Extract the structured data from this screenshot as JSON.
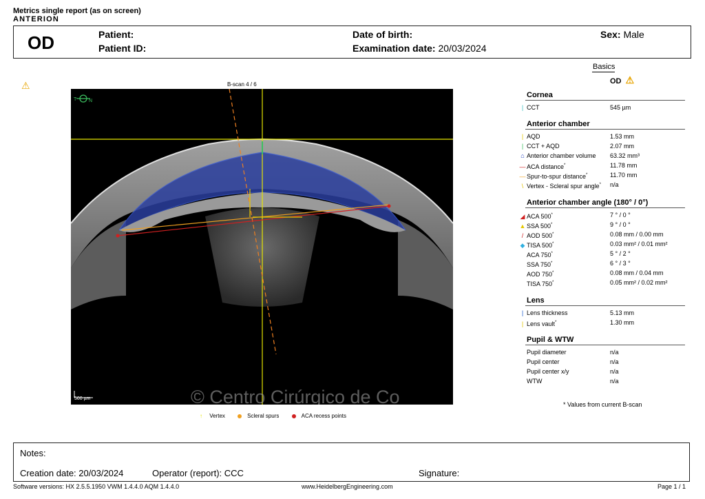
{
  "report": {
    "title": "Metrics single report (as on screen)",
    "brand": "ANTERION"
  },
  "header": {
    "eye": "OD",
    "patient_label": "Patient:",
    "patient_value": "",
    "patient_id_label": "Patient ID:",
    "patient_id_value": "",
    "dob_label": "Date of birth:",
    "dob_value": "",
    "exam_label": "Examination date:",
    "exam_value": "20/03/2024",
    "sex_label": "Sex:",
    "sex_value": "Male"
  },
  "basics": {
    "tab": "Basics",
    "eye": "OD"
  },
  "scan": {
    "caption": "B-scan  4  / 6",
    "orient_t": "T",
    "orient_n": "N",
    "scale_label": "500 µm",
    "watermark": "© Centro Cirúrgico de Co"
  },
  "legend": {
    "vertex": "Vertex",
    "scleral_spurs": "Scleral spurs",
    "aca_recess": "ACA recess points"
  },
  "sections": {
    "cornea": {
      "title": "Cornea",
      "rows": [
        {
          "label": "CCT",
          "value": "545 µm",
          "marker": "|",
          "color": "#3cc0c0",
          "asterisk": ""
        }
      ]
    },
    "anterior_chamber": {
      "title": "Anterior chamber",
      "rows": [
        {
          "label": "AQD",
          "value": "1.53 mm",
          "marker": "|",
          "color": "#e6c800",
          "asterisk": ""
        },
        {
          "label": "CCT + AQD",
          "value": "2.07 mm",
          "marker": "|",
          "color": "#3cc060",
          "asterisk": ""
        },
        {
          "label": "Anterior chamber volume",
          "value": "63.32 mm³",
          "marker": "⌂",
          "color": "#2040c0",
          "asterisk": ""
        },
        {
          "label": "ACA distance",
          "value": "11.78 mm",
          "marker": "—",
          "color": "#d02020",
          "asterisk": "*"
        },
        {
          "label": "Spur-to-spur distance",
          "value": "11.70 mm",
          "marker": "—",
          "color": "#f0a020",
          "asterisk": "*"
        },
        {
          "label": "Vertex - Scleral spur angle",
          "value": "n/a",
          "marker": "\\",
          "color": "#e0c000",
          "asterisk": "*"
        }
      ]
    },
    "chamber_angle": {
      "title": "Anterior chamber angle (180° / 0°)",
      "rows": [
        {
          "label": "ACA 500",
          "value": "7 ° / 0 °",
          "marker": "◢",
          "color": "#d02020",
          "asterisk": "*"
        },
        {
          "label": "SSA 500",
          "value": "9 ° / 0 °",
          "marker": "▲",
          "color": "#e6c800",
          "asterisk": "*"
        },
        {
          "label": "AOD 500",
          "value": "0.08 mm / 0.00 mm",
          "marker": "/",
          "color": "#d02020",
          "asterisk": "*"
        },
        {
          "label": "TISA 500",
          "value": "0.03 mm² / 0.01 mm²",
          "marker": "◆",
          "color": "#30b0e0",
          "asterisk": "*"
        },
        {
          "label": "ACA 750",
          "value": "5 ° / 2 °",
          "marker": "",
          "color": "#000000",
          "asterisk": "*"
        },
        {
          "label": "SSA 750",
          "value": "6 ° / 3 °",
          "marker": "",
          "color": "#000000",
          "asterisk": "*"
        },
        {
          "label": "AOD 750",
          "value": "0.08 mm / 0.04 mm",
          "marker": "",
          "color": "#000000",
          "asterisk": "*"
        },
        {
          "label": "TISA 750",
          "value": "0.05 mm² / 0.02 mm²",
          "marker": "",
          "color": "#000000",
          "asterisk": "*"
        }
      ]
    },
    "lens": {
      "title": "Lens",
      "rows": [
        {
          "label": "Lens thickness",
          "value": "5.13 mm",
          "marker": "|",
          "color": "#2060d0",
          "asterisk": ""
        },
        {
          "label": "Lens vault",
          "value": "1.30 mm",
          "marker": "|",
          "color": "#e6c800",
          "asterisk": "*"
        }
      ]
    },
    "pupil": {
      "title": "Pupil & WTW",
      "rows": [
        {
          "label": "Pupil diameter",
          "value": "n/a",
          "marker": "",
          "color": "#000000",
          "asterisk": ""
        },
        {
          "label": "Pupil center",
          "value": "n/a",
          "marker": "",
          "color": "#000000",
          "asterisk": ""
        },
        {
          "label": "Pupil center x/y",
          "value": "n/a",
          "marker": "",
          "color": "#000000",
          "asterisk": ""
        },
        {
          "label": "WTW",
          "value": "n/a",
          "marker": "",
          "color": "#000000",
          "asterisk": ""
        }
      ]
    }
  },
  "footnote": "* Values from current B-scan",
  "notes": {
    "notes_label": "Notes:",
    "creation_label": "Creation date:",
    "creation_value": "20/03/2024",
    "operator_label": "Operator (report):",
    "operator_value": "CCC",
    "signature_label": "Signature:"
  },
  "footer": {
    "software": "Software versions:  HX 2.5.5.1950 VWM 1.4.4.0  AQM 1.4.4.0",
    "website": "www.HeidelbergEngineering.com",
    "page": "Page  1 / 1"
  },
  "colors": {
    "warning": "#e7a400",
    "yellow_line": "#e6e600",
    "chamber_fill": "#2b3f9e"
  }
}
